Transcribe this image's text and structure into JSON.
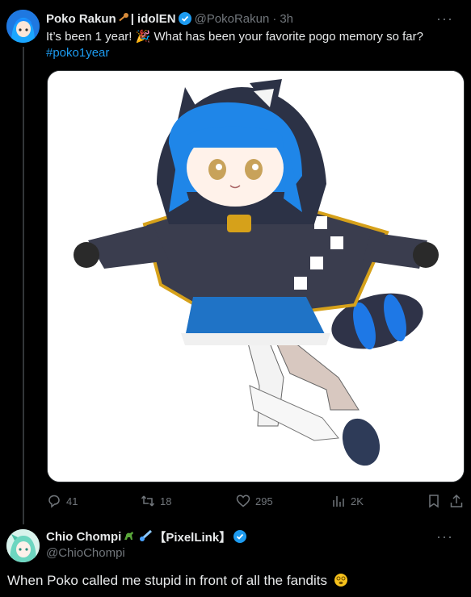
{
  "tweet": {
    "author_name": "Poko Rakun",
    "author_suffix": "| idolEN",
    "author_handle": "@PokoRakun",
    "separator": "·",
    "time": "3h",
    "text": "It’s been 1 year! 🎉 What has been your favorite pogo memory so far?",
    "hashtag": "#poko1year",
    "stats": {
      "replies": "41",
      "retweets": "18",
      "likes": "295",
      "views": "2K"
    }
  },
  "reply": {
    "author_name": "Chio Chompi",
    "author_tag": "【PixelLink】",
    "author_handle": "@ChioChompi",
    "text": "When Poko called me stupid in front of all the fandits"
  },
  "colors": {
    "background": "#000000",
    "text": "#e7e9ea",
    "muted": "#71767b",
    "link": "#1d9bf0",
    "verified": "#1d9bf0"
  },
  "icons": [
    "more-icon",
    "verified-icon",
    "key-emoji",
    "party-popper-emoji",
    "reply-icon",
    "retweet-icon",
    "like-icon",
    "views-icon",
    "bookmark-icon",
    "share-icon",
    "dinosaur-emoji",
    "comet-emoji",
    "spiral-eyes-emoji"
  ]
}
